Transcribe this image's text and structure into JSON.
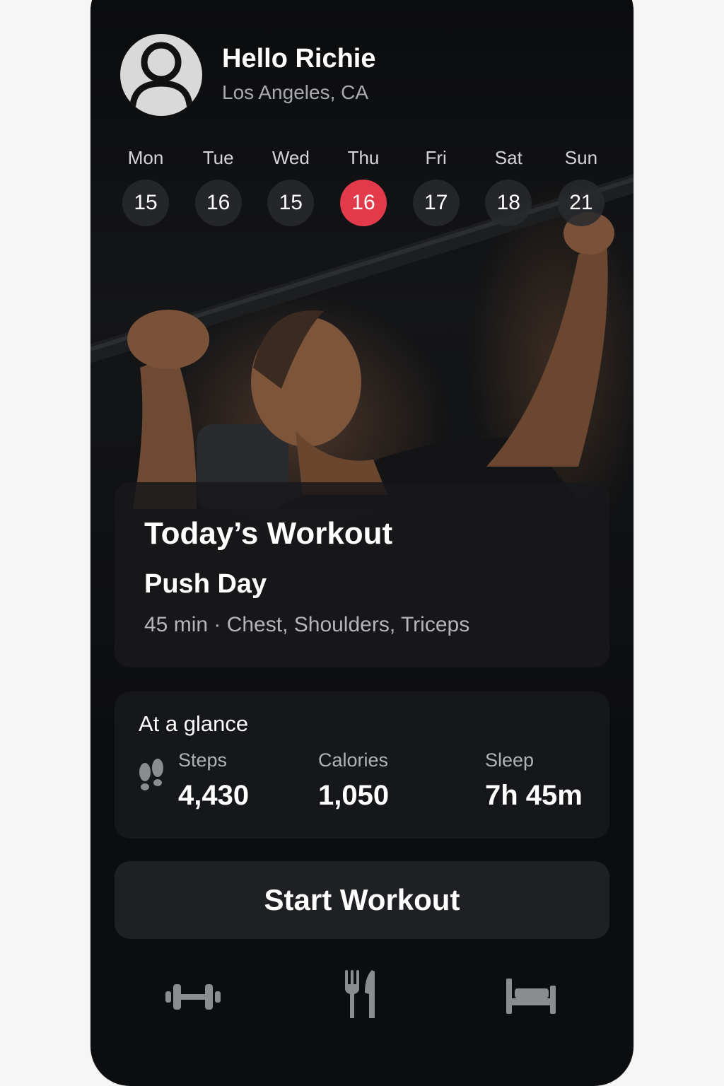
{
  "user": {
    "greeting": "Hello Richie",
    "location": "Los Angeles, CA"
  },
  "week": {
    "days": [
      {
        "name": "Mon",
        "date": "15"
      },
      {
        "name": "Tue",
        "date": "16"
      },
      {
        "name": "Wed",
        "date": "15"
      },
      {
        "name": "Thu",
        "date": "16",
        "selected": true
      },
      {
        "name": "Fri",
        "date": "17"
      },
      {
        "name": "Sat",
        "date": "18"
      },
      {
        "name": "Sun",
        "date": "21"
      }
    ]
  },
  "workout": {
    "heading": "Today’s Workout",
    "plan": "Push Day",
    "details": "45 min · Chest, Shoulders, Triceps"
  },
  "glance": {
    "title": "At a glance",
    "steps": {
      "label": "Steps",
      "value": "4,430"
    },
    "calories": {
      "label": "Calories",
      "value": "1,050"
    },
    "sleep": {
      "label": "Sleep",
      "value": "7h 45m"
    }
  },
  "actions": {
    "start_label": "Start Workout"
  },
  "tabs": [
    {
      "icon": "dumbbell-icon"
    },
    {
      "icon": "fork-knife-icon"
    },
    {
      "icon": "bed-icon"
    }
  ],
  "colors": {
    "accent": "#e23a4a",
    "background": "#0c0d0f",
    "card": "#15171a",
    "icon": "#8a8c90"
  }
}
